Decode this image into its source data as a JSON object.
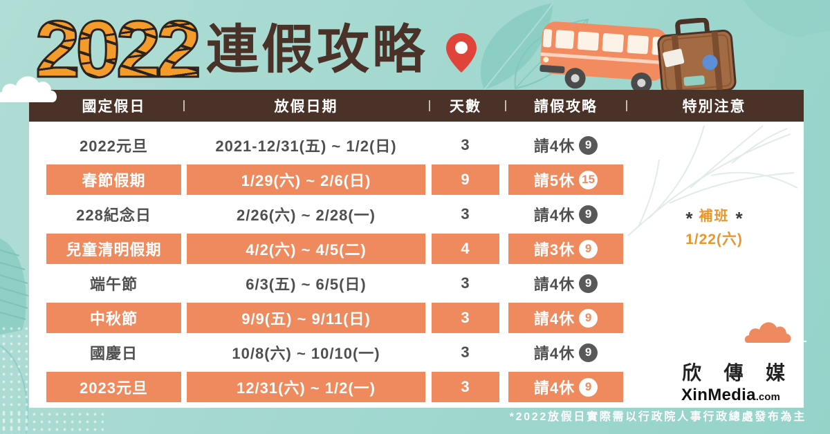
{
  "title": {
    "year": "2022",
    "heading": "連假攻略"
  },
  "icons": {
    "title_pin": "map-pin-icon"
  },
  "colors": {
    "header_bg": "#4b3228",
    "highlight_row": "#ef8a5e",
    "note_accent": "#e8962e",
    "pin": "#e0433a",
    "background": "#a3d8cf"
  },
  "table": {
    "headers": [
      "國定假日",
      "放假日期",
      "天數",
      "請假攻略",
      "特別注意"
    ],
    "rows": [
      {
        "holiday": "2022元旦",
        "dates": "2021-12/31(五) ~ 1/2(日)",
        "days": "3",
        "leave": "請4休",
        "total_off": "9"
      },
      {
        "holiday": "春節假期",
        "dates": "1/29(六) ~ 2/6(日)",
        "days": "9",
        "leave": "請5休",
        "total_off": "15"
      },
      {
        "holiday": "228紀念日",
        "dates": "2/26(六) ~ 2/28(一)",
        "days": "3",
        "leave": "請4休",
        "total_off": "9"
      },
      {
        "holiday": "兒童清明假期",
        "dates": "4/2(六) ~ 4/5(二)",
        "days": "4",
        "leave": "請3休",
        "total_off": "9"
      },
      {
        "holiday": "端午節",
        "dates": "6/3(五) ~ 6/5(日)",
        "days": "3",
        "leave": "請4休",
        "total_off": "9"
      },
      {
        "holiday": "中秋節",
        "dates": "9/9(五) ~ 9/11(日)",
        "days": "3",
        "leave": "請4休",
        "total_off": "9"
      },
      {
        "holiday": "國慶日",
        "dates": "10/8(六) ~ 10/10(一)",
        "days": "3",
        "leave": "請4休",
        "total_off": "9"
      },
      {
        "holiday": "2023元旦",
        "dates": "12/31(六) ~ 1/2(一)",
        "days": "3",
        "leave": "請4休",
        "total_off": "9"
      }
    ]
  },
  "special_note": {
    "marker": "*",
    "label": "補班",
    "date": "1/22(六)"
  },
  "brand": {
    "name": "欣傳媒",
    "site_main": "XinMedia",
    "site_suffix": ".com"
  },
  "footnote": "*2022放假日實際需以行政院人事行政總處發布為主"
}
